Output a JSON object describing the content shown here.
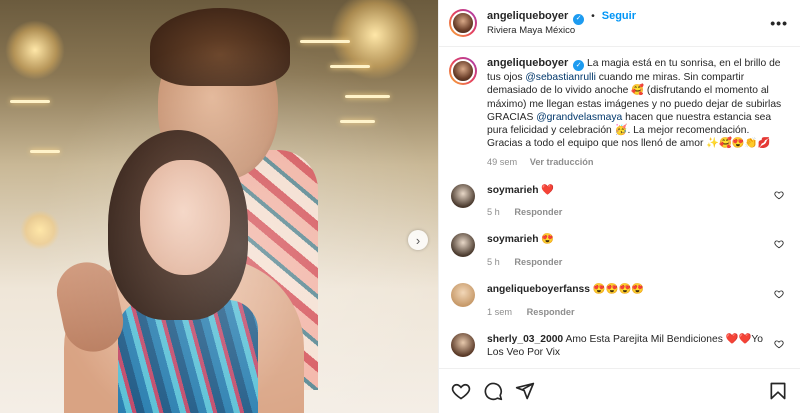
{
  "post": {
    "author": "angeliqueboyer",
    "follow_label": "Seguir",
    "location": "Riviera Maya México",
    "caption_parts": {
      "p1": "La magia está en tu sonrisa, en el brillo de tus ojos ",
      "mention1": "@sebastianrulli",
      "p2": " cuando me miras. Sin compartir demasiado de lo vivido anoche 🥰 (disfrutando el momento al máximo) me llegan estas imágenes y no puedo dejar de subirlas GRACIAS ",
      "mention2": "@grandvelasmaya",
      "p3": " hacen que nuestra estancia sea pura felicidad y celebración 🥳. La mejor recomendación.",
      "p4": "Gracias a todo el equipo que nos llenó de amor ✨🥰😍👏💋"
    },
    "time": "49 sem",
    "translate_label": "Ver traducción"
  },
  "comments": [
    {
      "user": "soymarieh",
      "text": "❤️",
      "time": "5 h",
      "reply": "Responder"
    },
    {
      "user": "soymarieh",
      "text": "😍",
      "time": "5 h",
      "reply": "Responder"
    },
    {
      "user": "angeliqueboyerfanss",
      "text": "😍😍😍😍",
      "time": "1 sem",
      "reply": "Responder"
    },
    {
      "user": "sherly_03_2000",
      "text": "Amo Esta Parejita Mil Bendiciones ❤️❤️Yo Los Veo Por Vix",
      "time": "",
      "reply": ""
    }
  ],
  "icons": {
    "verified": "verified-badge-icon",
    "more": "more-options-icon",
    "next": "chevron-right-icon",
    "like": "heart-icon",
    "comment": "comment-icon",
    "share": "share-icon",
    "save": "bookmark-icon"
  },
  "colors": {
    "accent": "#0095f6",
    "mention": "#00376b",
    "verified": "#1d9bf0",
    "muted": "#8e8e8e"
  }
}
